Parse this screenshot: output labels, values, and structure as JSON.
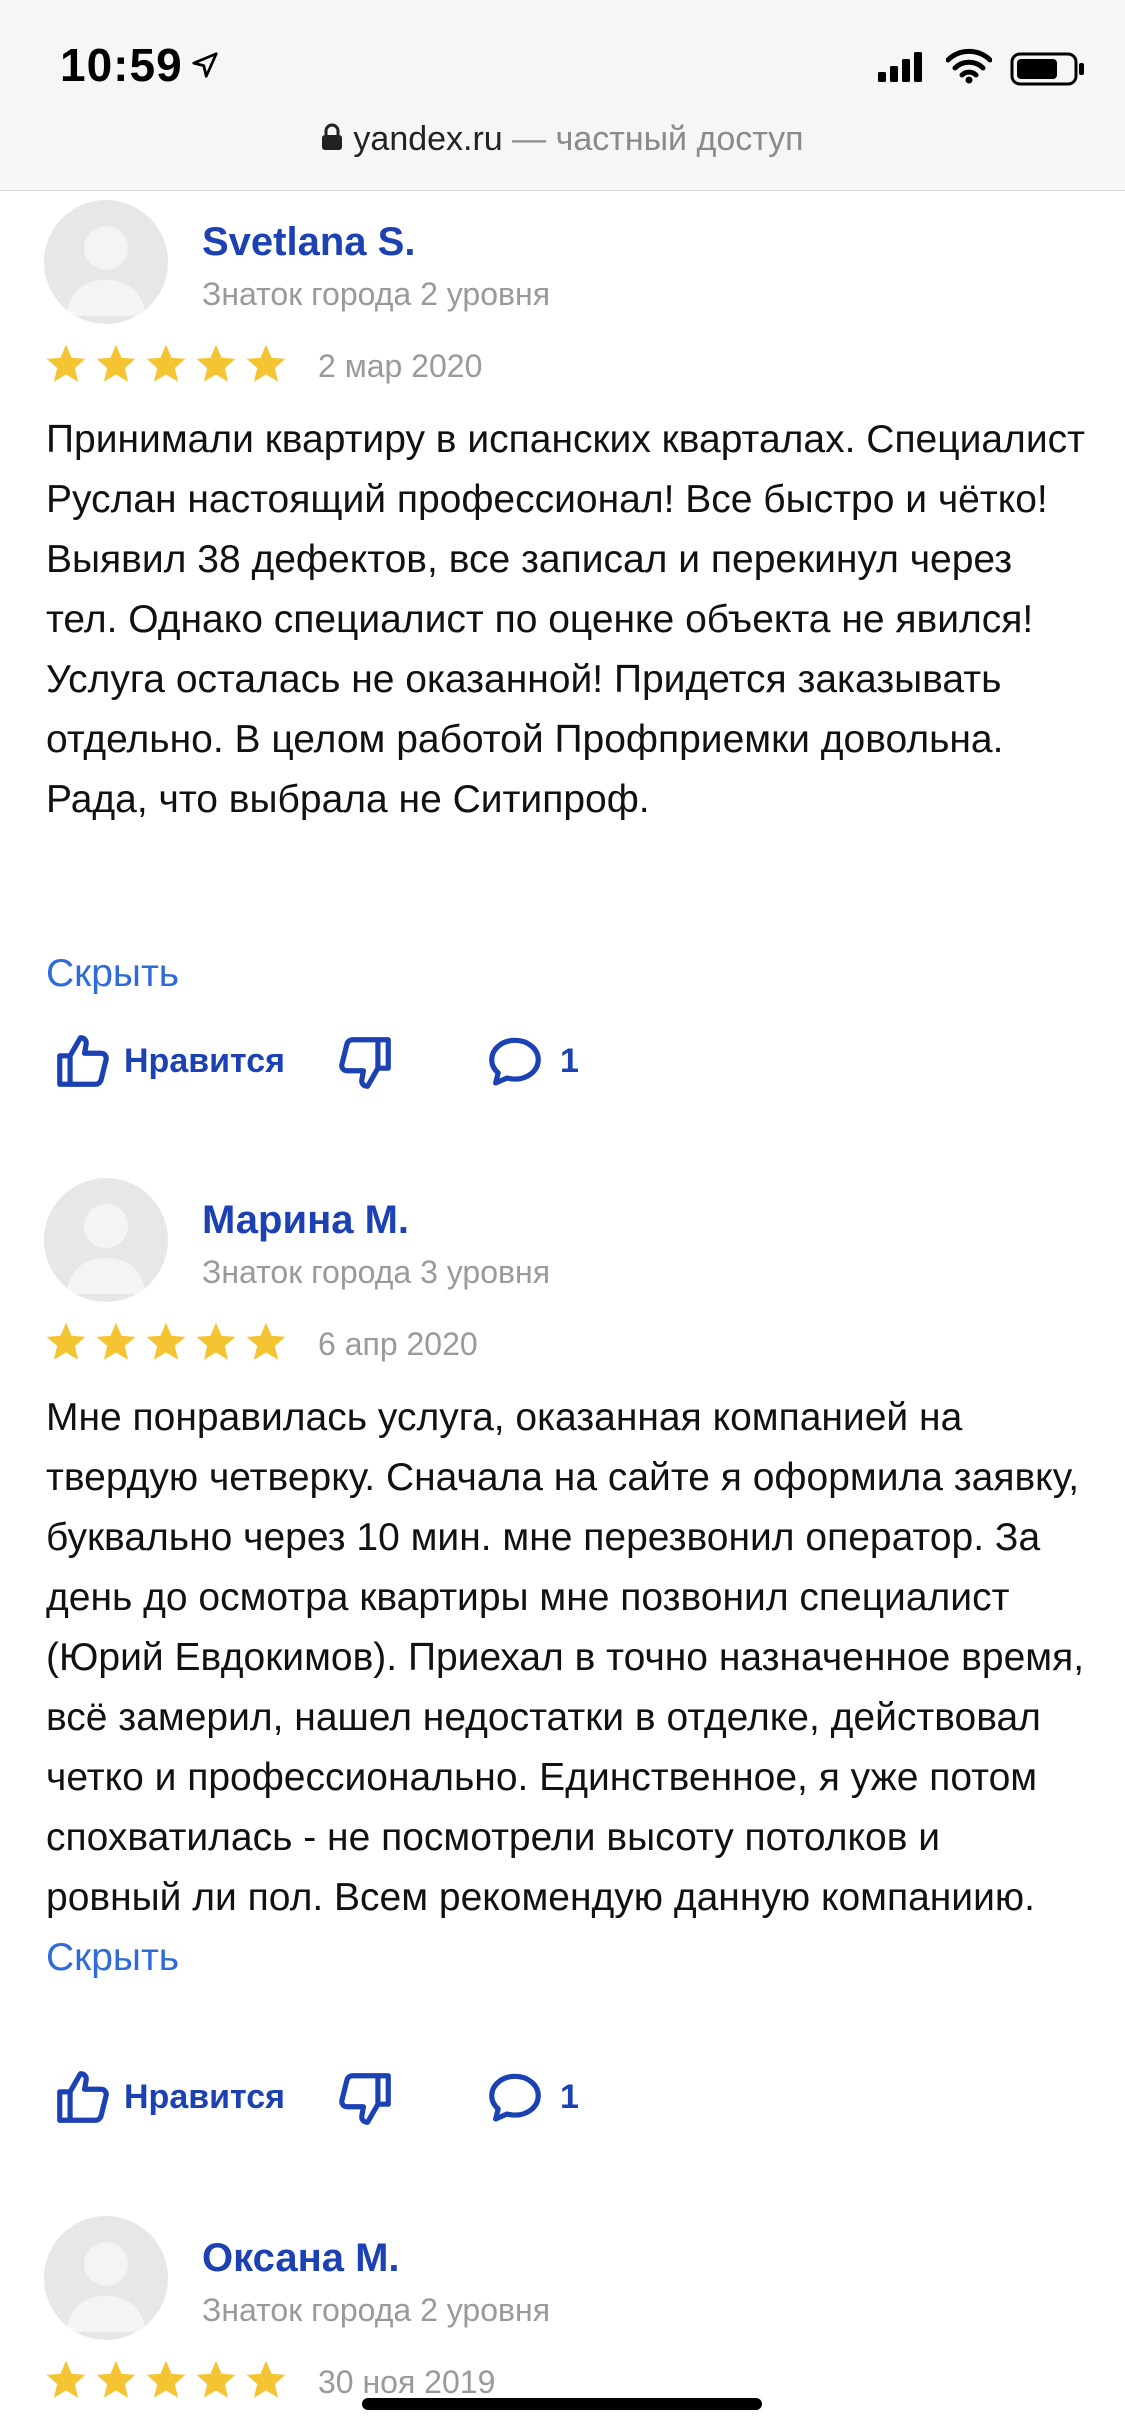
{
  "status_bar": {
    "time": "10:59"
  },
  "url_bar": {
    "domain": "yandex.ru",
    "suffix": " — частный доступ"
  },
  "colors": {
    "name": "#1b41b3",
    "link": "#2f6bd9",
    "star": "#f4c433",
    "muted": "#9a9a9a"
  },
  "reviews": [
    {
      "author": "Svetlana S.",
      "level": "Знаток города 2 уровня",
      "rating": 5,
      "date": "2 мар 2020",
      "text": "Принимали квартиру в испанских кварталах. Специалист Руслан настоящий профессионал! Все быстро и чётко! Выявил 38 дефектов, все записал и перекинул через тел. Однако специалист по оценке объекта не явился! Услуга осталась не оказанной! Придется заказывать отдельно. В целом работой Профприемки довольна. Рада, что выбрала не Ситипроф.",
      "hide_label": "Скрыть",
      "like_label": "Нравится",
      "comment_count": "1"
    },
    {
      "author": "Марина М.",
      "level": "Знаток города 3 уровня",
      "rating": 5,
      "date": "6 апр 2020",
      "text": "Мне понравилась услуга, оказанная компанией на твердую четверку. Сначала на сайте я оформила заявку, буквально через 10 мин. мне перезвонил оператор. За день до осмотра квартиры мне позвонил специалист (Юрий Евдокимов). Приехал в точно назначенное время, всё замерил, нашел недостатки в отделке, действовал четко и профессионально. Единственное, я уже потом спохватилась - не посмотрели высоту потолков и ровный ли пол. Всем рекомендую данную компаниию.",
      "hide_label": "Скрыть",
      "like_label": "Нравится",
      "comment_count": "1"
    },
    {
      "author": "Оксана М.",
      "level": "Знаток города 2 уровня",
      "rating": 5,
      "date": "30 ноя 2019"
    }
  ]
}
